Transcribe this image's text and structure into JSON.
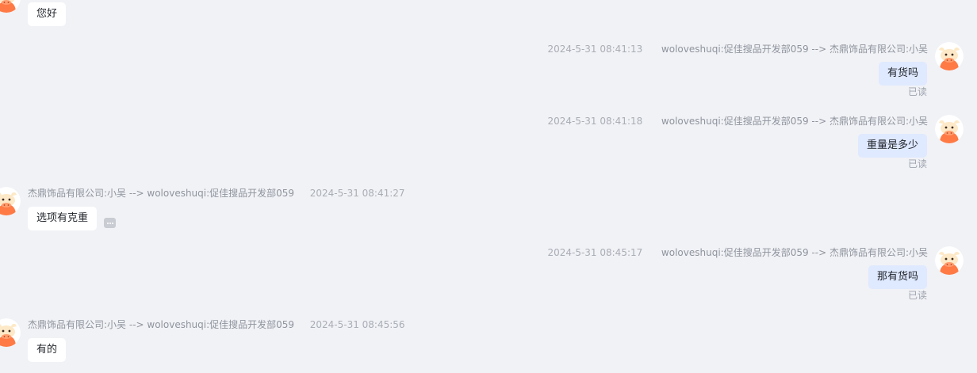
{
  "messages": [
    {
      "direction": "in",
      "text": "您好"
    },
    {
      "direction": "out",
      "time": "2024-5-31 08:41:13",
      "route": "woloveshuqi:促佳搜品开发部059 --> 杰鼎饰品有限公司:小吴",
      "text": "有货吗",
      "status": "已读"
    },
    {
      "direction": "out",
      "time": "2024-5-31 08:41:18",
      "route": "woloveshuqi:促佳搜品开发部059 --> 杰鼎饰品有限公司:小吴",
      "text": "重量是多少",
      "status": "已读"
    },
    {
      "direction": "in",
      "time": "2024-5-31 08:41:27",
      "route": "杰鼎饰品有限公司:小吴 --> woloveshuqi:促佳搜品开发部059",
      "text": "选项有克重"
    },
    {
      "direction": "out",
      "time": "2024-5-31 08:45:17",
      "route": "woloveshuqi:促佳搜品开发部059 --> 杰鼎饰品有限公司:小吴",
      "text": "那有货吗",
      "status": "已读"
    },
    {
      "direction": "in",
      "time": "2024-5-31 08:45:56",
      "route": "杰鼎饰品有限公司:小吴 --> woloveshuqi:促佳搜品开发部059",
      "text": "有的"
    }
  ],
  "colors": {
    "background": "#f1f2f6",
    "incoming_bubble": "#ffffff",
    "outgoing_bubble": "#dfe9ff",
    "avatar_face": "#ff7a45",
    "avatar_horn": "#fde9c7"
  }
}
